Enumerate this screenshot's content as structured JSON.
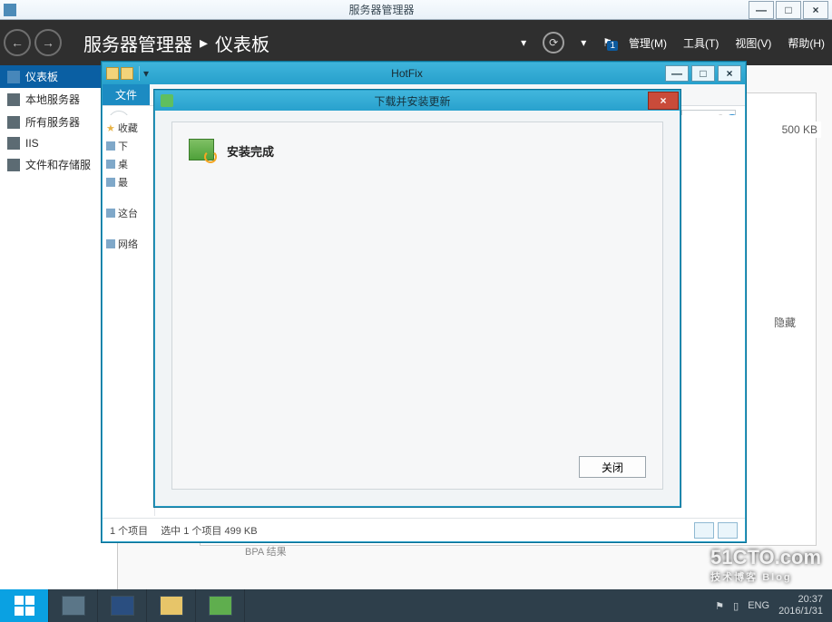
{
  "outer_window": {
    "title": "服务器管理器"
  },
  "server_manager": {
    "title_left": "服务器管理器",
    "title_right": "仪表板",
    "flag_badge": "1",
    "menu": {
      "manage": "管理(M)",
      "tools": "工具(T)",
      "view": "视图(V)",
      "help": "帮助(H)"
    },
    "sidebar": {
      "items": [
        {
          "label": "仪表板"
        },
        {
          "label": "本地服务器"
        },
        {
          "label": "所有服务器"
        },
        {
          "label": "IIS"
        },
        {
          "label": "文件和存储服"
        }
      ]
    },
    "bpa_label": "BPA 结果",
    "hide_label": "隐藏",
    "size_hint": "500 KB"
  },
  "explorer": {
    "title": "HotFix",
    "file_menu": "文件",
    "tree": {
      "favorites": "收藏",
      "item_t": "下",
      "item_e": "桌",
      "item_e2": "最",
      "this_pc": "这台",
      "network": "网络"
    },
    "status": {
      "count": "1 个项目",
      "selected": "选中 1 个项目  499 KB"
    }
  },
  "dialog": {
    "title": "下载并安装更新",
    "message": "安装完成",
    "close_button": "关闭"
  },
  "taskbar": {
    "time": "20:37",
    "date": "2016/1/31",
    "ime": "ENG"
  },
  "watermark": {
    "main": "51CTO.com",
    "sub": "技术博客  Blog"
  }
}
